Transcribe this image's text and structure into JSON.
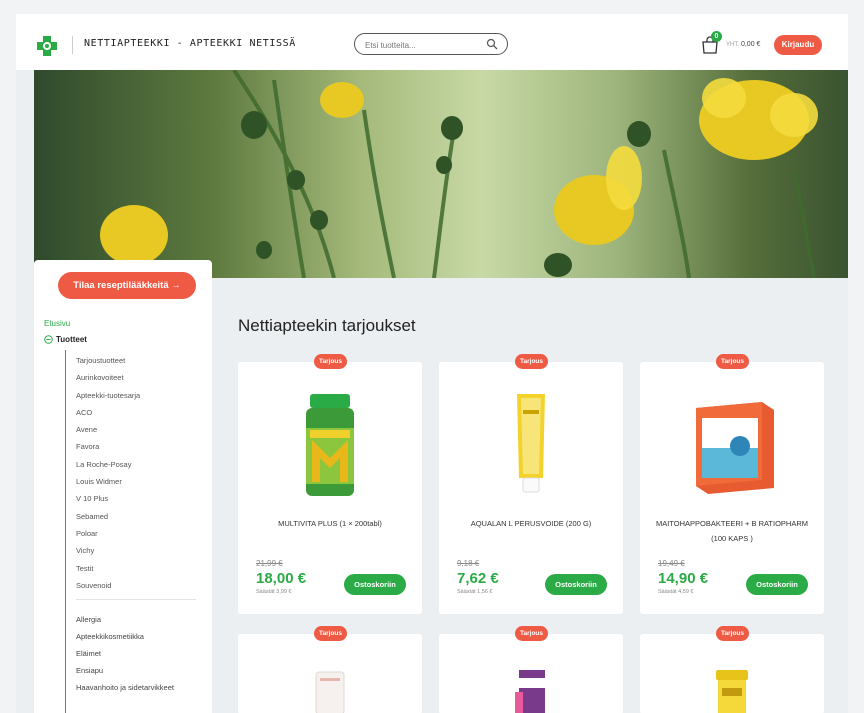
{
  "header": {
    "site_title": "NETTIAPTEEKKI - APTEEKKI NETISSÄ",
    "search_placeholder": "Etsi tuotteita...",
    "cart_count": "0",
    "cart_vat_label": "YHT.",
    "cart_total": "0,00 €",
    "login_label": "Kirjaudu"
  },
  "sidebar": {
    "prescription_button": "Tilaa reseptilääkkeitä →",
    "home": "Etusivu",
    "products": "Tuotteet",
    "product_categories": [
      "Tarjoustuotteet",
      "Aurinkovoiteet",
      "Apteekki-tuotesarja",
      "ACO",
      "Avene",
      "Favora",
      "La Roche-Posay",
      "Louis Widmer",
      "V 10 Plus",
      "Sebamed",
      "Poloar",
      "Vichy",
      "Testit",
      "Souvenoid"
    ],
    "other_categories": [
      "Allergia",
      "Apteekkikosmetiikka",
      "Eläimet",
      "Ensiapu",
      "Haavanhoito ja sidetarvikkeet"
    ]
  },
  "main": {
    "section_title": "Nettiapteekin tarjoukset",
    "badge_label": "Tarjous",
    "buy_label": "Ostoskoriin",
    "products": [
      {
        "name": "MULTIVITA PLUS (1 × 200tabl)",
        "old_price": "21,99 €",
        "price": "18,00 €",
        "saving": "Säästät 3,99 €"
      },
      {
        "name": "AQUALAN L PERUSVOIDE (200 G)",
        "old_price": "9,18 €",
        "price": "7,62 €",
        "saving": "Säästät 1,56 €"
      },
      {
        "name": "MAITOHAPPOBAKTEERI + B RATIOPHARM (100 KAPS )",
        "old_price": "19,49 €",
        "price": "14,90 €",
        "saving": "Säästät 4,59 €"
      }
    ]
  },
  "colors": {
    "accent_red": "#ef5a44",
    "accent_green": "#2bab46"
  }
}
